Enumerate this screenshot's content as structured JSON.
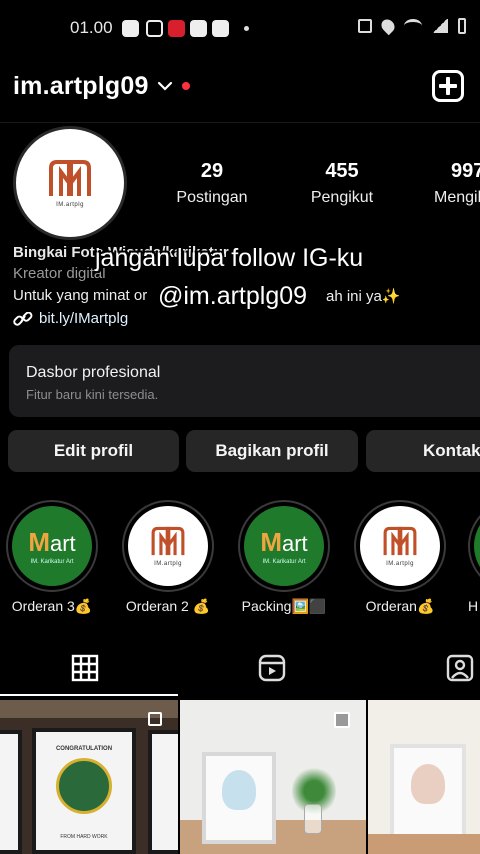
{
  "status_bar": {
    "time": "01.00"
  },
  "header": {
    "username": "im.artplg09"
  },
  "profile": {
    "logo_caption": "IM.artplg",
    "stats": [
      {
        "value": "29",
        "label": "Postingan"
      },
      {
        "value": "455",
        "label": "Pengikut"
      },
      {
        "value": "997",
        "label": "Mengikuti"
      }
    ],
    "bio_name": "Bingkai Foto Wisuda/karikatur",
    "bio_category": "Kreator digital",
    "bio_text_start": "Untuk yang minat or",
    "bio_text_end": "ah ini ya✨",
    "bio_link": "bit.ly/IMartplg"
  },
  "overlay": {
    "line1": "jangan lupa follow IG-ku",
    "line2": "@im.artplg09"
  },
  "dashboard": {
    "title": "Dasbor profesional",
    "subtitle": "Fitur baru kini tersedia."
  },
  "buttons": {
    "edit": "Edit profil",
    "share": "Bagikan profil",
    "contact": "Kontak"
  },
  "highlights": [
    {
      "label": "Orderan 3💰"
    },
    {
      "label": "Orderan 2 💰"
    },
    {
      "label": "Packing🖼️⬛"
    },
    {
      "label": "Orderan💰"
    },
    {
      "label": "H"
    }
  ],
  "highlight_art_text": {
    "brand": "art",
    "sub": "IM. Karikatur Art",
    "sub_white": "IM.artplg"
  },
  "grid_posts": [
    {
      "title": "CONGRATULATION",
      "footer": "FROM HARD WORK"
    },
    {
      "title": "",
      "footer": ""
    },
    {
      "title": "",
      "footer": ""
    }
  ],
  "colors": {
    "accent_red": "#ff3040",
    "highlight_green": "#1f7a2c",
    "logo_orange": "#c0502a"
  },
  "icons": [
    "plus-square-icon",
    "chevron-down-icon",
    "link-icon",
    "grid-icon",
    "reels-icon",
    "tagged-icon"
  ]
}
